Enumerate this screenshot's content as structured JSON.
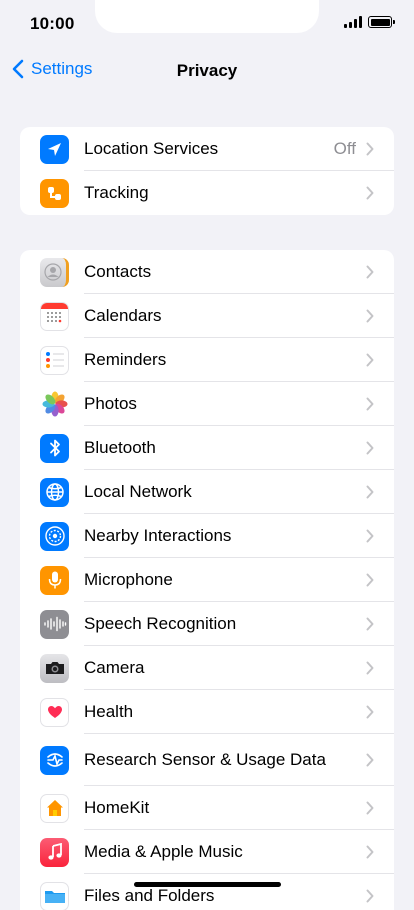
{
  "status_bar": {
    "time": "10:00"
  },
  "nav": {
    "back_label": "Settings",
    "title": "Privacy"
  },
  "group1": [
    {
      "label": "Location Services",
      "value": "Off",
      "icon": "location-arrow-icon",
      "color": "#007aff"
    },
    {
      "label": "Tracking",
      "icon": "tracking-icon",
      "color": "#ff9500"
    }
  ],
  "group2": [
    {
      "label": "Contacts",
      "icon": "contacts-icon"
    },
    {
      "label": "Calendars",
      "icon": "calendar-icon"
    },
    {
      "label": "Reminders",
      "icon": "reminders-icon"
    },
    {
      "label": "Photos",
      "icon": "photos-icon"
    },
    {
      "label": "Bluetooth",
      "icon": "bluetooth-icon",
      "color": "#007aff"
    },
    {
      "label": "Local Network",
      "icon": "globe-icon",
      "color": "#007aff"
    },
    {
      "label": "Nearby Interactions",
      "icon": "nearby-interactions-icon",
      "color": "#007aff"
    },
    {
      "label": "Microphone",
      "icon": "microphone-icon",
      "color": "#ff9500"
    },
    {
      "label": "Speech Recognition",
      "icon": "waveform-icon",
      "color": "#8e8e93"
    },
    {
      "label": "Camera",
      "icon": "camera-icon"
    },
    {
      "label": "Health",
      "icon": "heart-icon",
      "color": "#ff2d55"
    },
    {
      "label": "Research Sensor & Usage Data",
      "icon": "research-icon",
      "color": "#007aff"
    },
    {
      "label": "HomeKit",
      "icon": "home-icon",
      "color": "#ff9500"
    },
    {
      "label": "Media & Apple Music",
      "icon": "music-note-icon",
      "color": "#fc3c44"
    },
    {
      "label": "Files and Folders",
      "icon": "folder-icon",
      "color": "#1e9bf0"
    }
  ]
}
